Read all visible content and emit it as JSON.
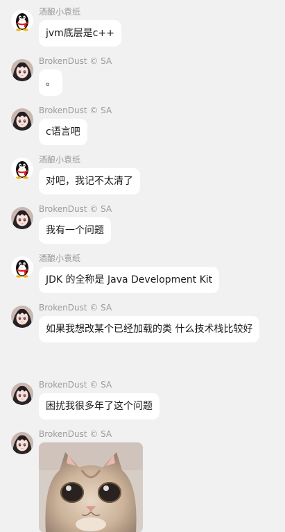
{
  "chat": {
    "messages": [
      {
        "sender": "酒酿小袁纸",
        "avatar": "qq-penguin-icon",
        "text": "jvm底层是c++"
      },
      {
        "sender": "BrokenDust © SA",
        "avatar": "anime-girl-avatar",
        "text": "。"
      },
      {
        "sender": "BrokenDust © SA",
        "avatar": "anime-girl-avatar",
        "text": "c语言吧"
      },
      {
        "sender": "酒酿小袁纸",
        "avatar": "qq-penguin-icon",
        "text": "对吧，我记不太清了"
      },
      {
        "sender": "BrokenDust © SA",
        "avatar": "anime-girl-avatar",
        "text": "我有一个问题"
      },
      {
        "sender": "酒酿小袁纸",
        "avatar": "qq-penguin-icon",
        "text": "JDK 的全称是 Java Development Kit"
      },
      {
        "sender": "BrokenDust © SA",
        "avatar": "anime-girl-avatar",
        "text": "如果我想改某个已经加载的类 什么技术栈比较好"
      },
      {
        "sender": "BrokenDust © SA",
        "avatar": "anime-girl-avatar",
        "text": "困扰我很多年了这个问题"
      },
      {
        "sender": "BrokenDust © SA",
        "avatar": "anime-girl-avatar",
        "sticker": "kitten-sticker"
      }
    ]
  }
}
